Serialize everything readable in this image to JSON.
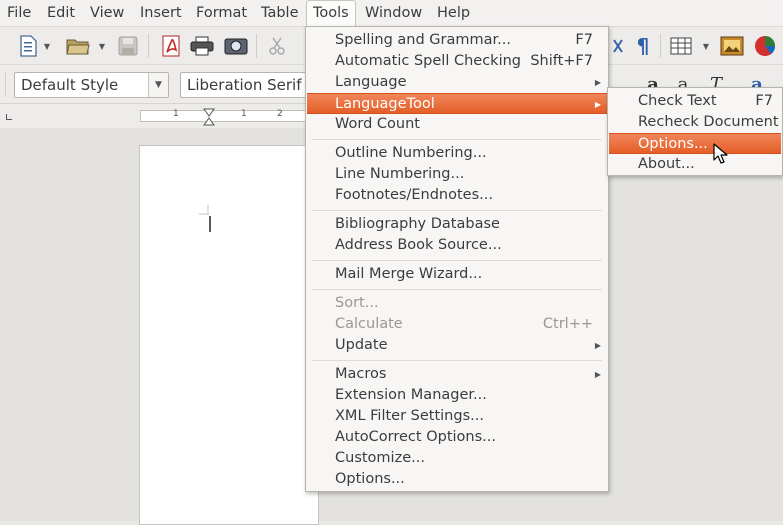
{
  "menubar": {
    "items": [
      {
        "label": "File"
      },
      {
        "label": "Edit"
      },
      {
        "label": "View"
      },
      {
        "label": "Insert"
      },
      {
        "label": "Format"
      },
      {
        "label": "Table"
      },
      {
        "label": "Tools"
      },
      {
        "label": "Window"
      },
      {
        "label": "Help"
      }
    ]
  },
  "toolbar": {
    "paragraph_style": "Default Style",
    "font_name": "Liberation Serif"
  },
  "tools_menu": {
    "items": [
      {
        "label": "Spelling and Grammar...",
        "shortcut": "F7"
      },
      {
        "label": "Automatic Spell Checking",
        "shortcut": "Shift+F7"
      },
      {
        "label": "Language"
      },
      {
        "label": "LanguageTool"
      },
      {
        "label": "Word Count"
      },
      {
        "label": "Outline Numbering..."
      },
      {
        "label": "Line Numbering..."
      },
      {
        "label": "Footnotes/Endnotes..."
      },
      {
        "label": "Bibliography Database"
      },
      {
        "label": "Address Book Source..."
      },
      {
        "label": "Mail Merge Wizard..."
      },
      {
        "label": "Sort..."
      },
      {
        "label": "Calculate",
        "shortcut": "Ctrl++"
      },
      {
        "label": "Update"
      },
      {
        "label": "Macros"
      },
      {
        "label": "Extension Manager..."
      },
      {
        "label": "XML Filter Settings..."
      },
      {
        "label": "AutoCorrect Options..."
      },
      {
        "label": "Customize..."
      },
      {
        "label": "Options..."
      }
    ]
  },
  "languagetool_menu": {
    "items": [
      {
        "label": "Check Text",
        "shortcut": "F7"
      },
      {
        "label": "Recheck Document"
      },
      {
        "label": "Options..."
      },
      {
        "label": "About..."
      }
    ]
  },
  "ruler": {
    "tick1": "1",
    "tick2": "1",
    "tick3": "2"
  },
  "colors": {
    "highlight": "#e8692f",
    "menu_bg": "#f7f6f5"
  }
}
